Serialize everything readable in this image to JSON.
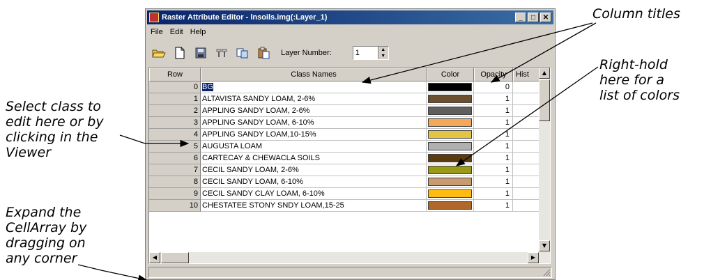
{
  "window": {
    "title": "Raster Attribute Editor - lnsoils.img(:Layer_1)",
    "controls": {
      "minimize": "_",
      "maximize": "□",
      "close": "✕"
    }
  },
  "menu": [
    "File",
    "Edit",
    "Help"
  ],
  "toolbar": {
    "icons": [
      "open-folder-icon",
      "new-page-icon",
      "save-icon",
      "criteria-icon",
      "copy-icon",
      "paste-icon"
    ],
    "layer_label": "Layer Number:",
    "layer_value": "1"
  },
  "table": {
    "headers": [
      "Row",
      "Class Names",
      "Color",
      "Opacity",
      "Hist"
    ],
    "rows": [
      {
        "row": "0",
        "name": "BG",
        "color": "#000000",
        "opacity": "0"
      },
      {
        "row": "1",
        "name": "ALTAVISTA SANDY LOAM, 2-6%",
        "color": "#6b5030",
        "opacity": "1"
      },
      {
        "row": "2",
        "name": "APPLING SANDY LOAM, 2-6%",
        "color": "#5f5f5f",
        "opacity": "1"
      },
      {
        "row": "3",
        "name": "APPLING SANDY LOAM, 6-10%",
        "color": "#f5a858",
        "opacity": "1"
      },
      {
        "row": "4",
        "name": "APPLING SANDY LOAM,10-15%",
        "color": "#e2c544",
        "opacity": "1"
      },
      {
        "row": "5",
        "name": "AUGUSTA LOAM",
        "color": "#b0b0b0",
        "opacity": "1"
      },
      {
        "row": "6",
        "name": "CARTECAY & CHEWACLA SOILS",
        "color": "#5c3a10",
        "opacity": "1"
      },
      {
        "row": "7",
        "name": "CECIL SANDY LOAM, 2-6%",
        "color": "#9a9a18",
        "opacity": "1"
      },
      {
        "row": "8",
        "name": "CECIL SANDY LOAM, 6-10%",
        "color": "#c89a70",
        "opacity": "1"
      },
      {
        "row": "9",
        "name": "CECIL SANDY CLAY LOAM, 6-10%",
        "color": "#ffbb10",
        "opacity": "1"
      },
      {
        "row": "10",
        "name": "CHESTATEE STONY SNDY LOAM,15-25",
        "color": "#b0682a",
        "opacity": "1"
      }
    ]
  },
  "annotations": {
    "column_titles": "Column titles",
    "right_hold": "Right-hold\nhere for a\nlist of colors",
    "select_class": "Select class to\nedit here or by\nclicking in the\nViewer",
    "expand": "Expand the\nCellArray by\ndragging on\nany corner"
  }
}
